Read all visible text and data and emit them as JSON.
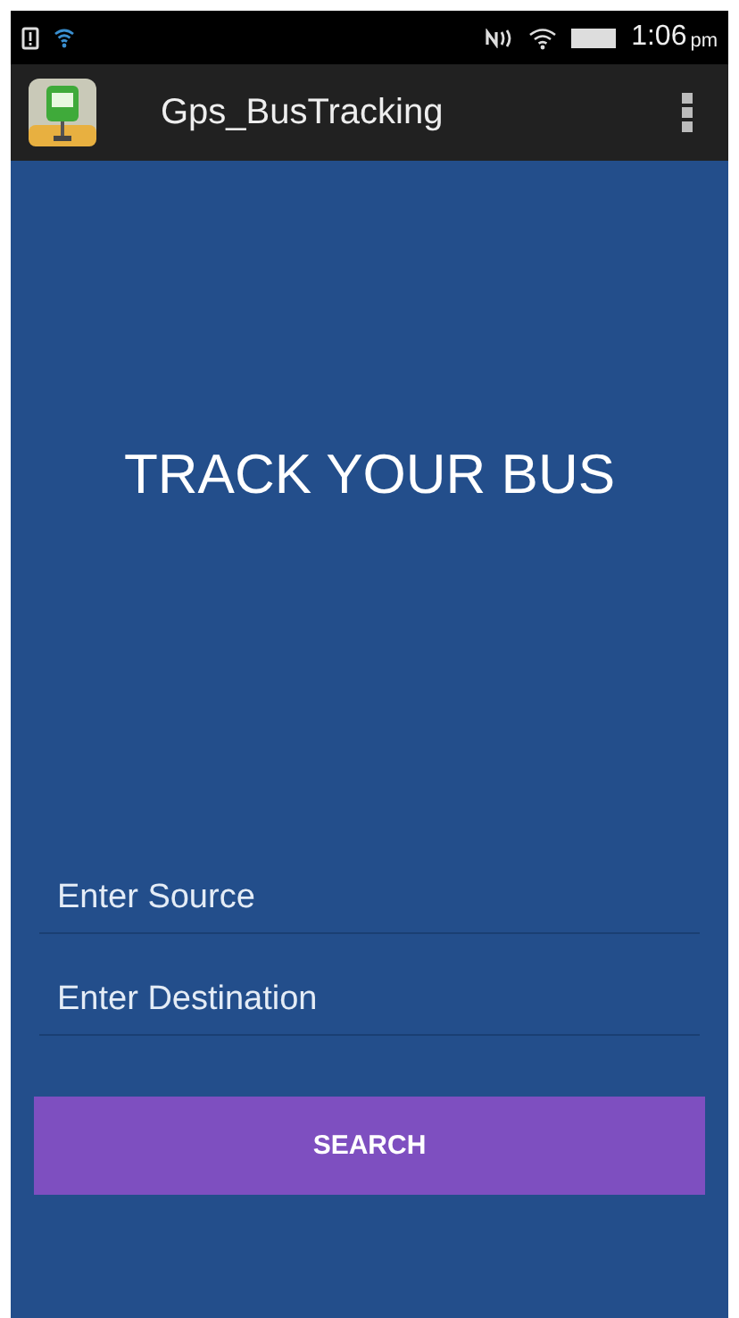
{
  "status_bar": {
    "time": "1:06",
    "period": "pm"
  },
  "app_bar": {
    "title": "Gps_BusTracking"
  },
  "heading": "TRACK YOUR BUS",
  "fields": [
    {
      "placeholder": "Enter Source"
    },
    {
      "placeholder": "Enter Destination"
    }
  ],
  "buttons": [
    "SEARCH"
  ]
}
